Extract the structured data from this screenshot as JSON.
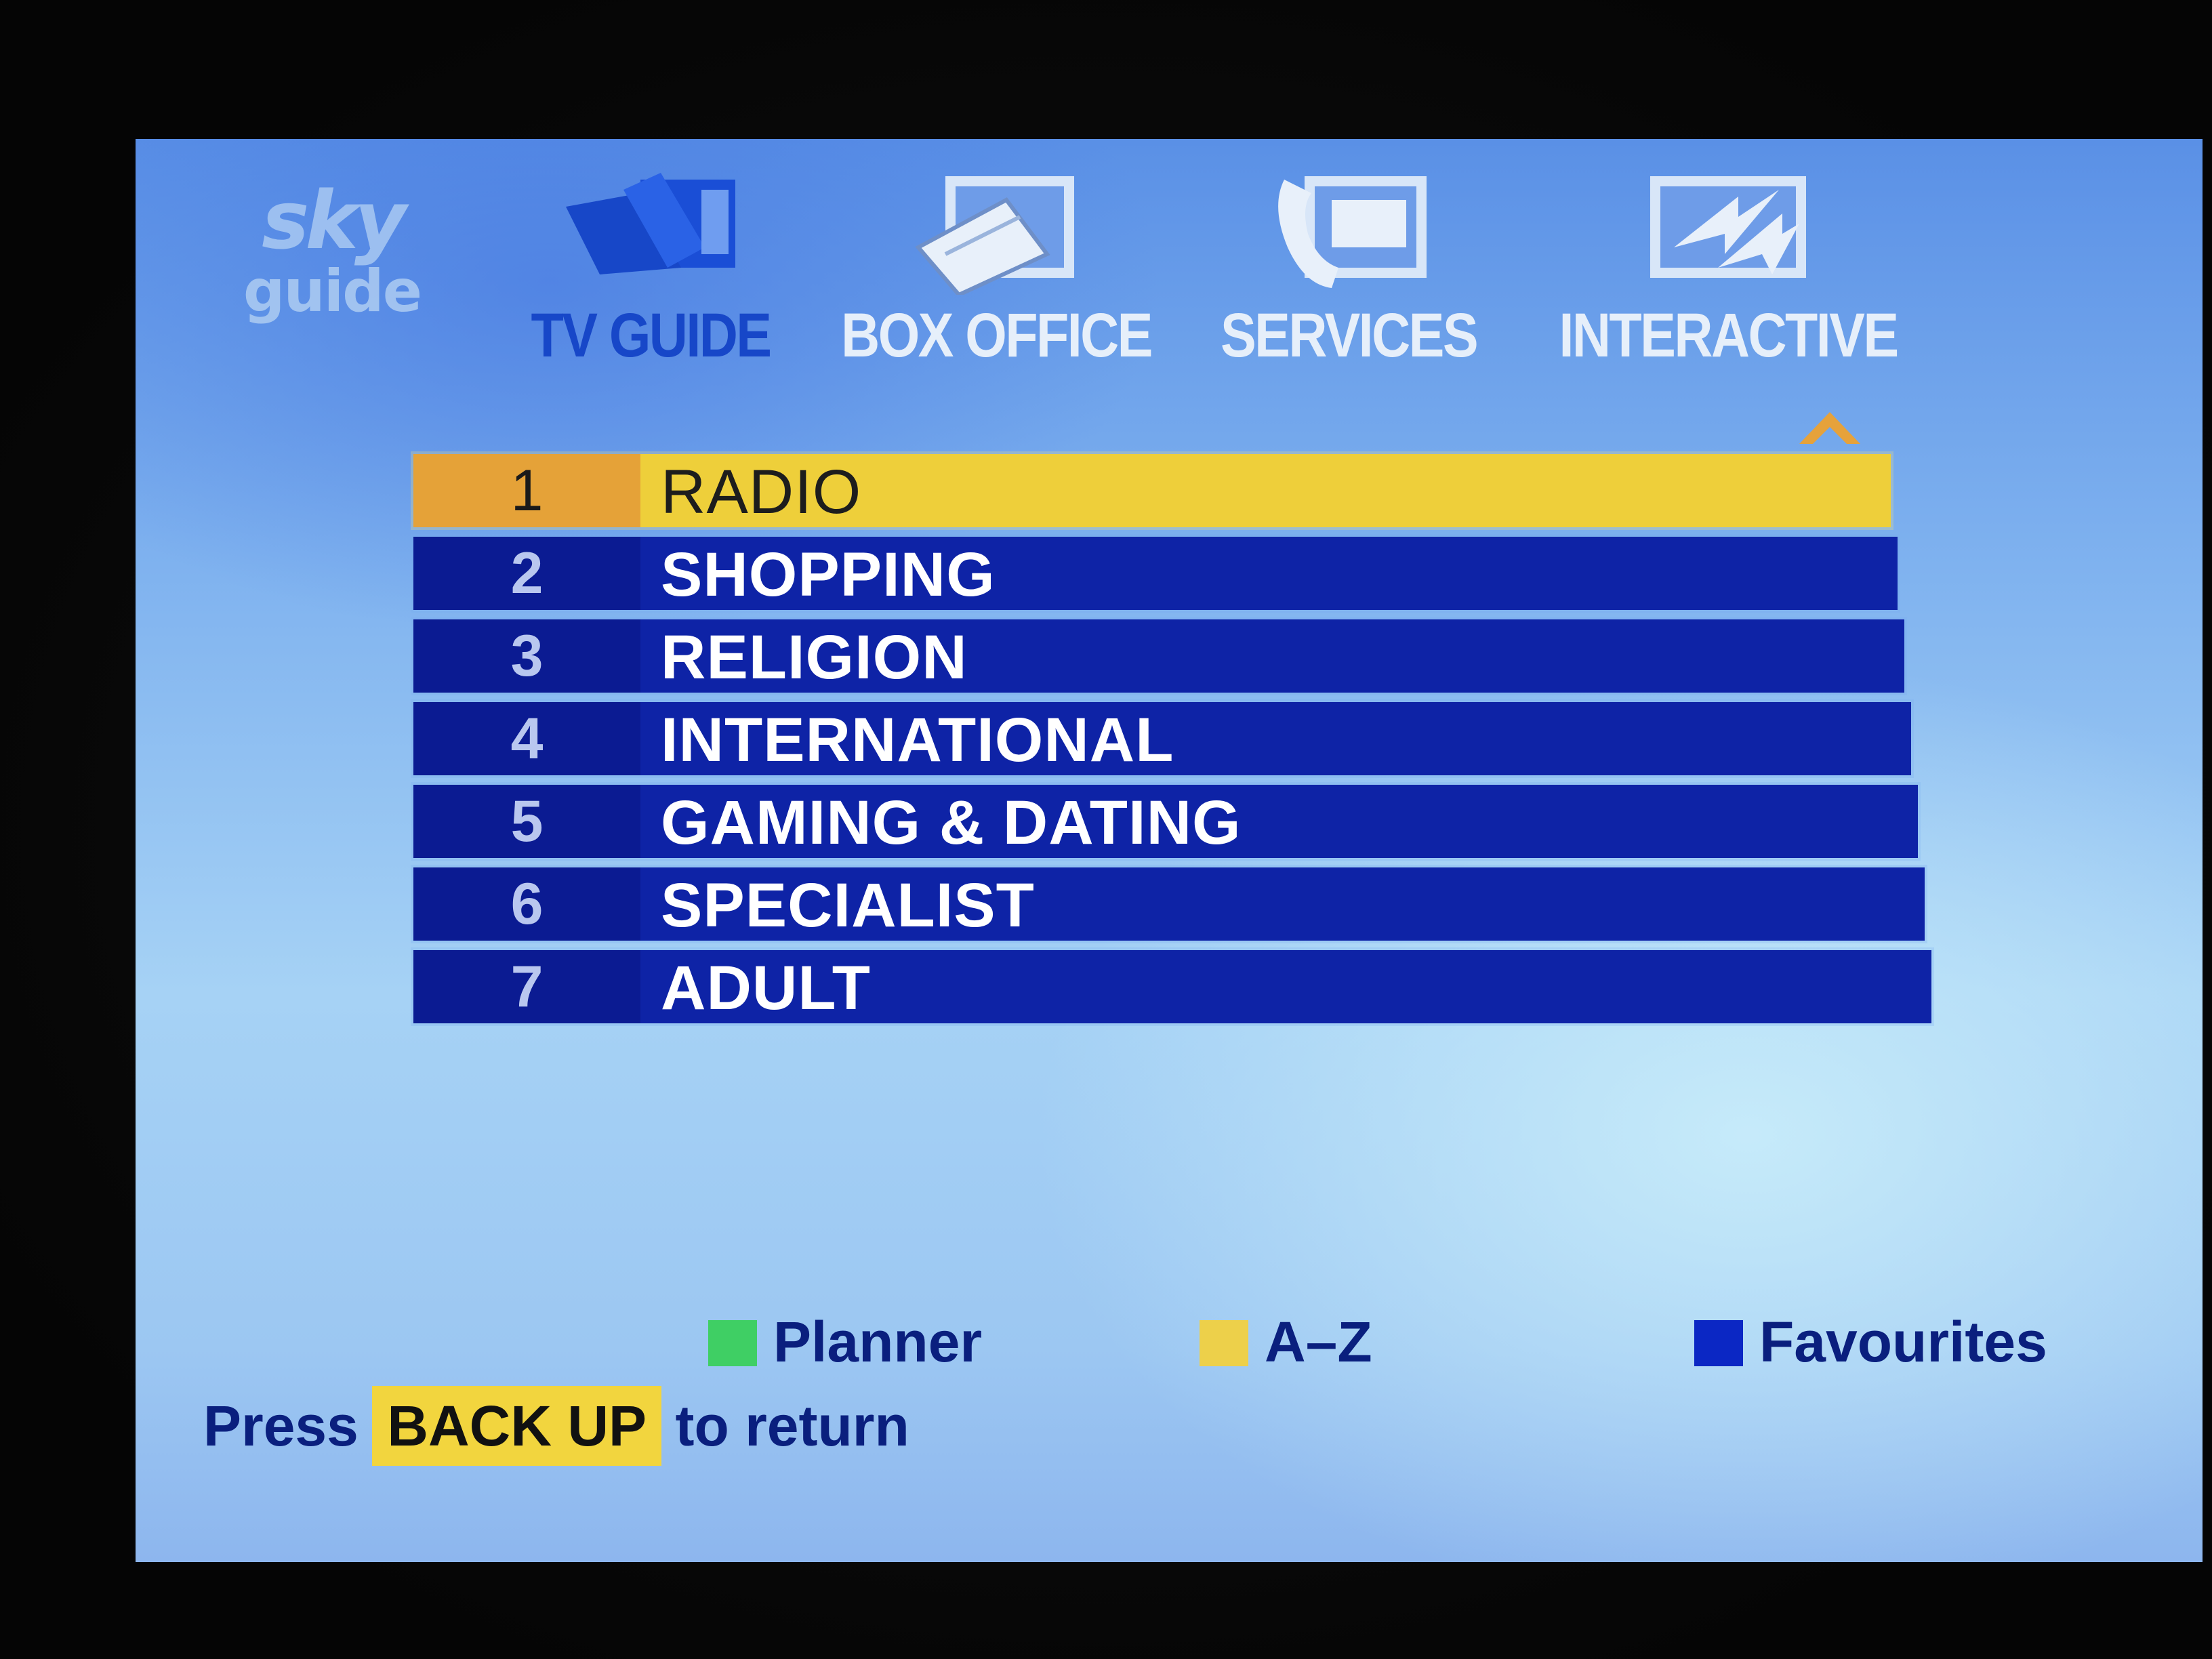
{
  "logo": {
    "brand": "sky",
    "subtitle": "guide"
  },
  "nav": {
    "tabs": [
      {
        "label": "TV GUIDE",
        "icon": "tv-guide-icon",
        "active": true
      },
      {
        "label": "BOX OFFICE",
        "icon": "box-office-ticket-icon",
        "active": false
      },
      {
        "label": "SERVICES",
        "icon": "services-phone-icon",
        "active": false
      },
      {
        "label": "INTERACTIVE",
        "icon": "interactive-arrows-icon",
        "active": false
      }
    ]
  },
  "scroll": {
    "icon": "scroll-up-arrow-icon"
  },
  "menu": {
    "selected_index": 0,
    "items": [
      {
        "number": "1",
        "label": "RADIO"
      },
      {
        "number": "2",
        "label": "SHOPPING"
      },
      {
        "number": "3",
        "label": "RELIGION"
      },
      {
        "number": "4",
        "label": "INTERNATIONAL"
      },
      {
        "number": "5",
        "label": "GAMING & DATING"
      },
      {
        "number": "6",
        "label": "SPECIALIST"
      },
      {
        "number": "7",
        "label": "ADULT"
      }
    ]
  },
  "legend": {
    "planner": {
      "label": "Planner",
      "color": "#3fcf64"
    },
    "az": {
      "label": "A–Z",
      "color": "#edd04a"
    },
    "favourites": {
      "label": "Favourites",
      "color": "#0b27c4"
    }
  },
  "footer": {
    "press": "Press",
    "key": "BACK UP",
    "suffix": "to return"
  },
  "colors": {
    "screen_blue": "#7fb2ef",
    "row_blue": "#0e23a6",
    "row_selected": "#eecf3a",
    "number_selected": "#e5a238",
    "active_tab": "#1747c8"
  }
}
